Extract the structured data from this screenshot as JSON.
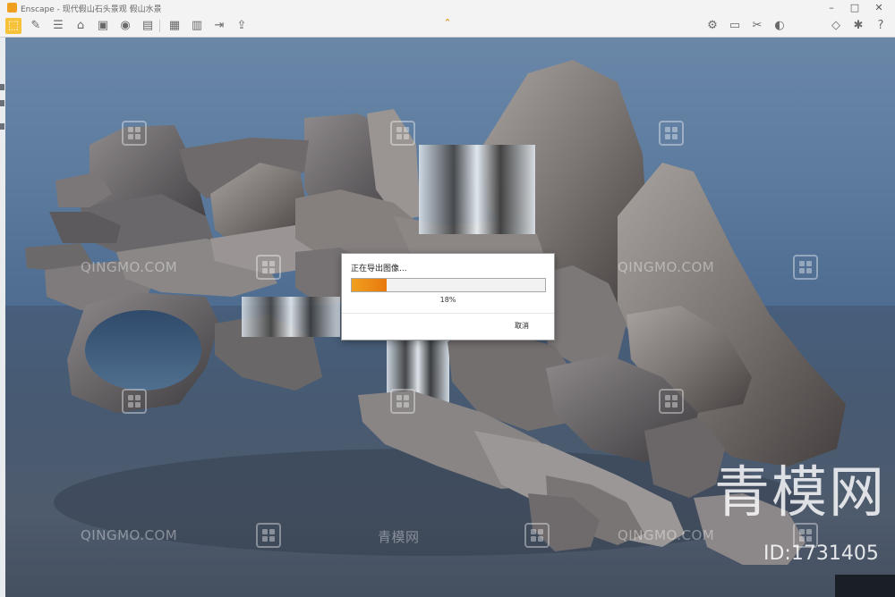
{
  "window": {
    "title": "Enscape - 现代假山石头景观 假山水景"
  },
  "controls": {
    "minimize": "–",
    "maximize": "□",
    "close": "✕"
  },
  "toolbar": {
    "icons": [
      "select-icon",
      "feather-icon",
      "list-icon",
      "gamepad-icon",
      "home-icon",
      "camera-icon",
      "screenshot-icon",
      "panorama-icon",
      "video-icon",
      "export-icon",
      "settings-icon",
      "capture-icon",
      "clip-icon",
      "help-icon"
    ],
    "collapse_glyph": "⌃"
  },
  "dialog": {
    "title": "正在导出图像...",
    "progress": 18,
    "progress_text": "18%",
    "cancel_label": "取消",
    "accent": "#f0a020"
  },
  "watermark": {
    "site": "QINGMO.COM",
    "site_cn": "青模网",
    "logo": "青模网",
    "id_label": "ID:1731405"
  }
}
